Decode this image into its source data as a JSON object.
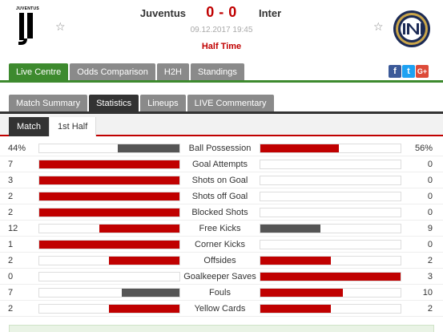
{
  "match": {
    "home_team": "Juventus",
    "away_team": "Inter",
    "score": "0 - 0",
    "datetime": "09.12.2017 19:45",
    "status": "Half Time",
    "home_logo_text": "JUVENTUS"
  },
  "icons": {
    "favorite": "star-outline-icon",
    "home_logo": "juventus-logo",
    "away_logo": "inter-logo"
  },
  "top_tabs": [
    "Live Centre",
    "Odds Comparison",
    "H2H",
    "Standings"
  ],
  "social": {
    "facebook": "f",
    "twitter": "t",
    "google": "G+"
  },
  "sub_tabs": [
    "Match Summary",
    "Statistics",
    "Lineups",
    "LIVE Commentary"
  ],
  "period_tabs": [
    "Match",
    "1st Half"
  ],
  "colors": {
    "green": "#3d8a2e",
    "red": "#c00000",
    "dark": "#333333",
    "grey_bar": "#555555"
  },
  "stats": [
    {
      "label": "Ball Possession",
      "home": "44%",
      "away": "56%",
      "home_val": 44,
      "away_val": 56
    },
    {
      "label": "Goal Attempts",
      "home": "7",
      "away": "0",
      "home_val": 7,
      "away_val": 0
    },
    {
      "label": "Shots on Goal",
      "home": "3",
      "away": "0",
      "home_val": 3,
      "away_val": 0
    },
    {
      "label": "Shots off Goal",
      "home": "2",
      "away": "0",
      "home_val": 2,
      "away_val": 0
    },
    {
      "label": "Blocked Shots",
      "home": "2",
      "away": "0",
      "home_val": 2,
      "away_val": 0
    },
    {
      "label": "Free Kicks",
      "home": "12",
      "away": "9",
      "home_val": 12,
      "away_val": 9
    },
    {
      "label": "Corner Kicks",
      "home": "1",
      "away": "0",
      "home_val": 1,
      "away_val": 0
    },
    {
      "label": "Offsides",
      "home": "2",
      "away": "2",
      "home_val": 2,
      "away_val": 2
    },
    {
      "label": "Goalkeeper Saves",
      "home": "0",
      "away": "3",
      "home_val": 0,
      "away_val": 3
    },
    {
      "label": "Fouls",
      "home": "7",
      "away": "10",
      "home_val": 7,
      "away_val": 10
    },
    {
      "label": "Yellow Cards",
      "home": "2",
      "away": "2",
      "home_val": 2,
      "away_val": 2
    }
  ]
}
